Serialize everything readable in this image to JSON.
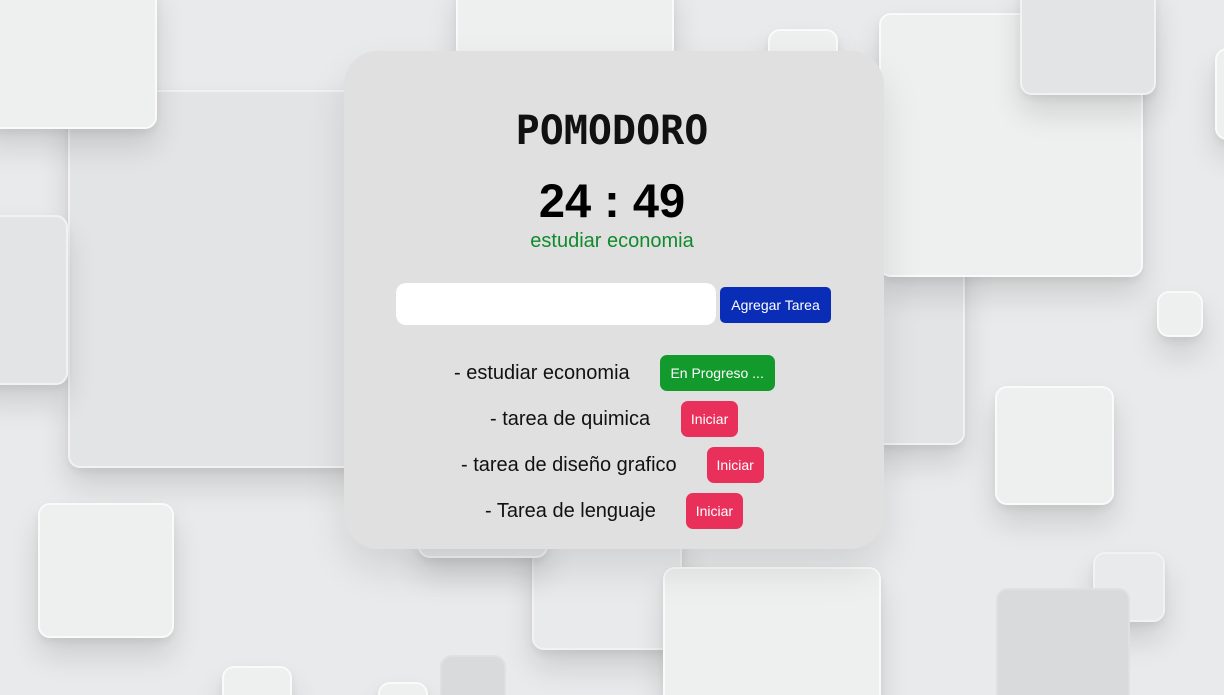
{
  "app": {
    "title": "POMODORO",
    "timer": "24 : 49",
    "current_task": "estudiar economia"
  },
  "colors": {
    "current_task_text": "#118a2c",
    "add_button": "#0a2db8",
    "progress_button": "#129a2c",
    "start_button": "#e8305a",
    "card_background": "#e0e0e0"
  },
  "form": {
    "input_value": "",
    "input_placeholder": "",
    "add_button_label": "Agregar Tarea"
  },
  "tasks": [
    {
      "label": "- estudiar economia",
      "button_label": "En Progreso ...",
      "status": "in-progress"
    },
    {
      "label": "- tarea de quimica",
      "button_label": "Iniciar",
      "status": "pending"
    },
    {
      "label": "- tarea de diseño grafico",
      "button_label": "Iniciar",
      "status": "pending"
    },
    {
      "label": "- Tarea de lenguaje",
      "button_label": "Iniciar",
      "status": "pending"
    }
  ]
}
